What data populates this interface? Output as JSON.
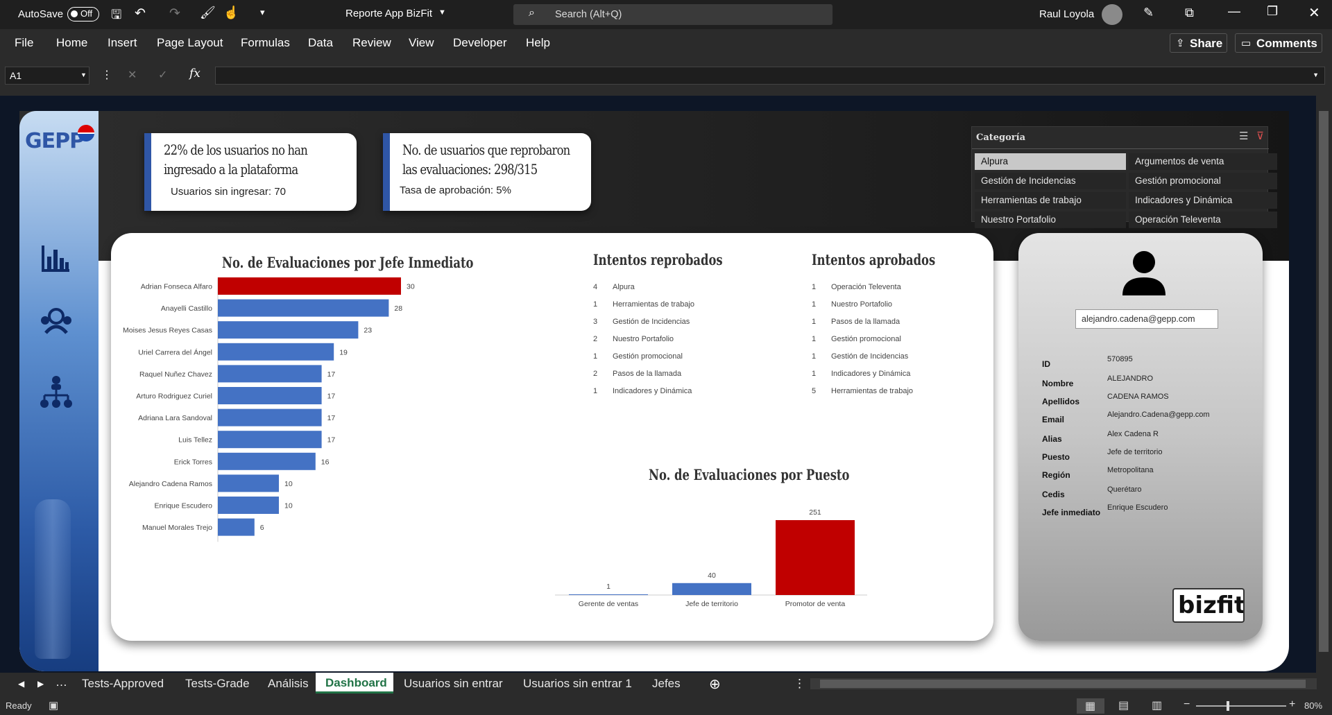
{
  "titlebar": {
    "autosave": "AutoSave",
    "toggle": "Off",
    "filename": "Reporte App BizFit",
    "search_placeholder": "Search (Alt+Q)",
    "user": "Raul Loyola"
  },
  "ribbon": {
    "tabs": [
      "File",
      "Home",
      "Insert",
      "Page Layout",
      "Formulas",
      "Data",
      "Review",
      "View",
      "Developer",
      "Help"
    ],
    "share": "Share",
    "comments": "Comments"
  },
  "formula_bar": {
    "cell_ref": "A1",
    "fx": "fx"
  },
  "logo": "GEPP",
  "kpi1": {
    "line1": "22% de los usuarios no han",
    "line2": "ingresado a la plataforma",
    "sub": "Usuarios sin ingresar:  70"
  },
  "kpi2": {
    "line1": "No. de usuarios que reprobaron",
    "line2": "las evaluaciones: 298/315",
    "sub": "Tasa de aprobación: 5%"
  },
  "slicer": {
    "title": "Categoría",
    "items": [
      "Alpura",
      "Argumentos de venta",
      "Gestión de Incidencias",
      "Gestión promocional",
      "Herramientas de trabajo",
      "Indicadores y Dinámica",
      "Nuestro Portafolio",
      "Operación Televenta"
    ]
  },
  "chart_data": [
    {
      "type": "bar",
      "orientation": "horizontal",
      "title": "No. de Evaluaciones por Jefe Inmediato",
      "categories": [
        "Adrian Fonseca Alfaro",
        "Anayelli Castillo",
        "Moises Jesus Reyes Casas",
        "Uriel Carrera del Ángel",
        "Raquel Nuñez Chavez",
        "Arturo Rodriguez Curiel",
        "Adriana Lara Sandoval",
        "Luis Tellez",
        "Erick Torres",
        "Alejandro Cadena Ramos",
        "Enrique Escudero",
        "Manuel Morales Trejo"
      ],
      "values": [
        30,
        28,
        23,
        19,
        17,
        17,
        17,
        17,
        16,
        10,
        10,
        6
      ],
      "highlight_color": "#c00000",
      "bar_color": "#4472c4"
    },
    {
      "type": "bar",
      "orientation": "vertical",
      "title": "No. de Evaluaciones por Puesto",
      "categories": [
        "Gerente de ventas",
        "Jefe de territorio",
        "Promotor de venta"
      ],
      "values": [
        1,
        40,
        251
      ],
      "highlight_color": "#c00000",
      "bar_color": "#4472c4"
    }
  ],
  "reprobados": {
    "title": "Intentos reprobados",
    "rows": [
      [
        "4",
        "Alpura"
      ],
      [
        "1",
        "Herramientas de trabajo"
      ],
      [
        "3",
        "Gestión de Incidencias"
      ],
      [
        "2",
        "Nuestro Portafolio"
      ],
      [
        "1",
        "Gestión promocional"
      ],
      [
        "2",
        "Pasos de la llamada"
      ],
      [
        "1",
        "Indicadores y Dinámica"
      ]
    ]
  },
  "aprobados": {
    "title": "Intentos aprobados",
    "rows": [
      [
        "1",
        "Operación Televenta"
      ],
      [
        "1",
        "Nuestro Portafolio"
      ],
      [
        "1",
        "Pasos de la llamada"
      ],
      [
        "1",
        "Gestión promocional"
      ],
      [
        "1",
        "Gestión de Incidencias"
      ],
      [
        "1",
        "Indicadores y Dinámica"
      ],
      [
        "5",
        "Herramientas de trabajo"
      ]
    ]
  },
  "profile": {
    "email_box": "alejandro.cadena@gepp.com",
    "fields": [
      [
        "ID",
        "570895"
      ],
      [
        "Nombre",
        "ALEJANDRO"
      ],
      [
        "Apellidos",
        "CADENA RAMOS"
      ],
      [
        "Email",
        "Alejandro.Cadena@gepp.com"
      ],
      [
        "Alias",
        "Alex Cadena R"
      ],
      [
        "Puesto",
        "Jefe de territorio"
      ],
      [
        "Región",
        "Metropolitana"
      ],
      [
        "Cedis",
        "Querétaro"
      ],
      [
        "Jefe inmediato",
        "Enrique Escudero"
      ]
    ],
    "brand": "bizfit"
  },
  "sheet_tabs": [
    "Tests-Approved",
    "Tests-Grade",
    "Análisis",
    "Dashboard",
    "Usuarios sin entrar",
    "Usuarios sin entrar 1",
    "Jefes"
  ],
  "status": {
    "ready": "Ready",
    "zoom": "80%"
  }
}
